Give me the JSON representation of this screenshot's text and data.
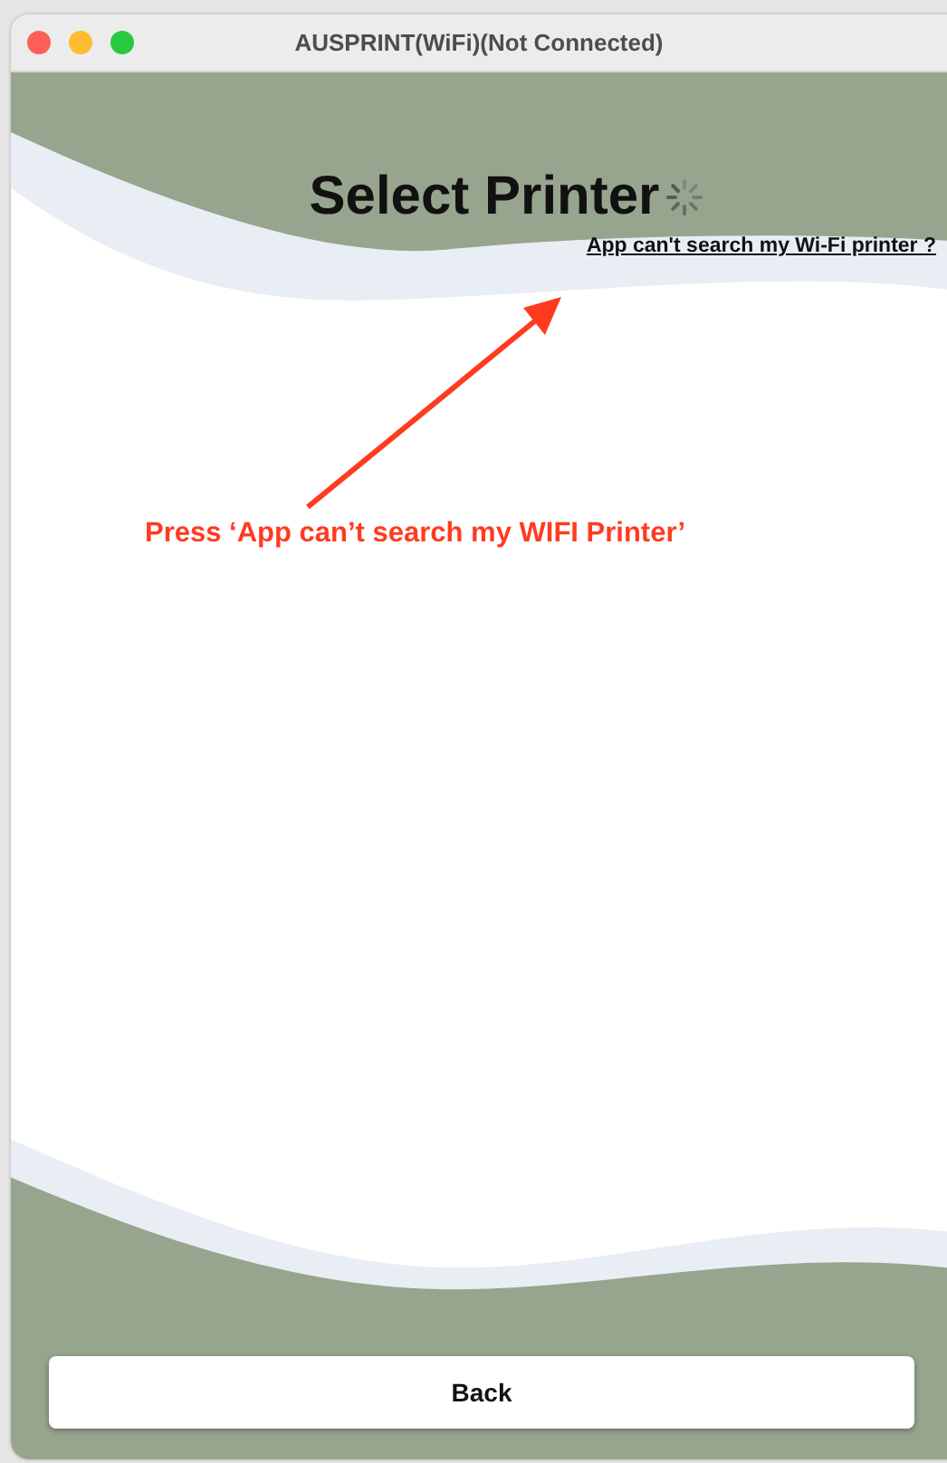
{
  "window": {
    "title": "AUSPRINT(WiFi)(Not Connected)"
  },
  "heading": "Select Printer",
  "help_link": "App can't search my Wi-Fi printer ?",
  "annotation": {
    "text": "Press ‘App can’t search my WIFI Printer’"
  },
  "buttons": [
    {
      "label": "Back"
    }
  ]
}
